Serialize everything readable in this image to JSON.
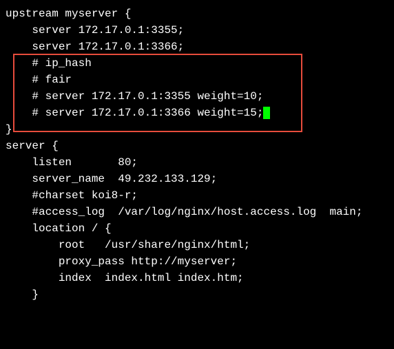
{
  "lines": {
    "l1": "upstream myserver {",
    "l2": "    server 172.17.0.1:3355;",
    "l3": "    server 172.17.0.1:3366;",
    "l4": "    # ip_hash",
    "l5": "    # fair",
    "l6": "    # server 172.17.0.1:3355 weight=10;",
    "l7": "    # server 172.17.0.1:3366 weight=15;",
    "l8": "}",
    "l9": "",
    "l10": "server {",
    "l11": "    listen       80;",
    "l12": "    server_name  49.232.133.129;",
    "l13": "",
    "l14": "    #charset koi8-r;",
    "l15": "    #access_log  /var/log/nginx/host.access.log  main;",
    "l16": "",
    "l17": "    location / {",
    "l18": "        root   /usr/share/nginx/html;",
    "l19": "        proxy_pass http://myserver;",
    "l20": "        index  index.html index.htm;",
    "l21": "    }"
  }
}
